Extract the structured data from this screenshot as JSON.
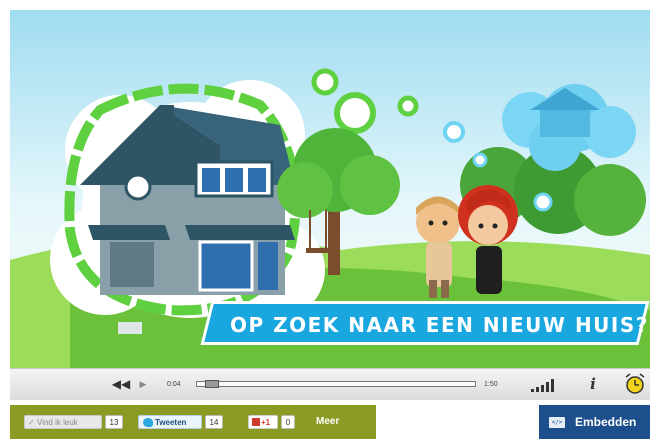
{
  "video": {
    "banner_title": "OP ZOEK NAAR EEN NIEUW HUIS?"
  },
  "controls": {
    "rewind_icon": "rewind-icon",
    "play_icon": "play-icon",
    "current_time": "0:04",
    "total_time": "1:50",
    "progress_fraction": 0.03,
    "info_label": "i",
    "volume_icon": "volume-icon",
    "chapters_icon": "clock-icon"
  },
  "social": {
    "like_label": "Vind ik leuk",
    "like_count": "13",
    "tweet_label": "Tweeten",
    "tweet_count": "14",
    "gplus_label": "+1",
    "gplus_count": "0",
    "more_label": "Meer"
  },
  "embed": {
    "icon_label": "</>",
    "label": "Embedden"
  },
  "colors": {
    "sky": "#cfeff7",
    "grass": "#7fd04a",
    "banner": "#1aa7e0",
    "social_bar": "#8a9a22",
    "embed_bar": "#1d4f8c"
  }
}
